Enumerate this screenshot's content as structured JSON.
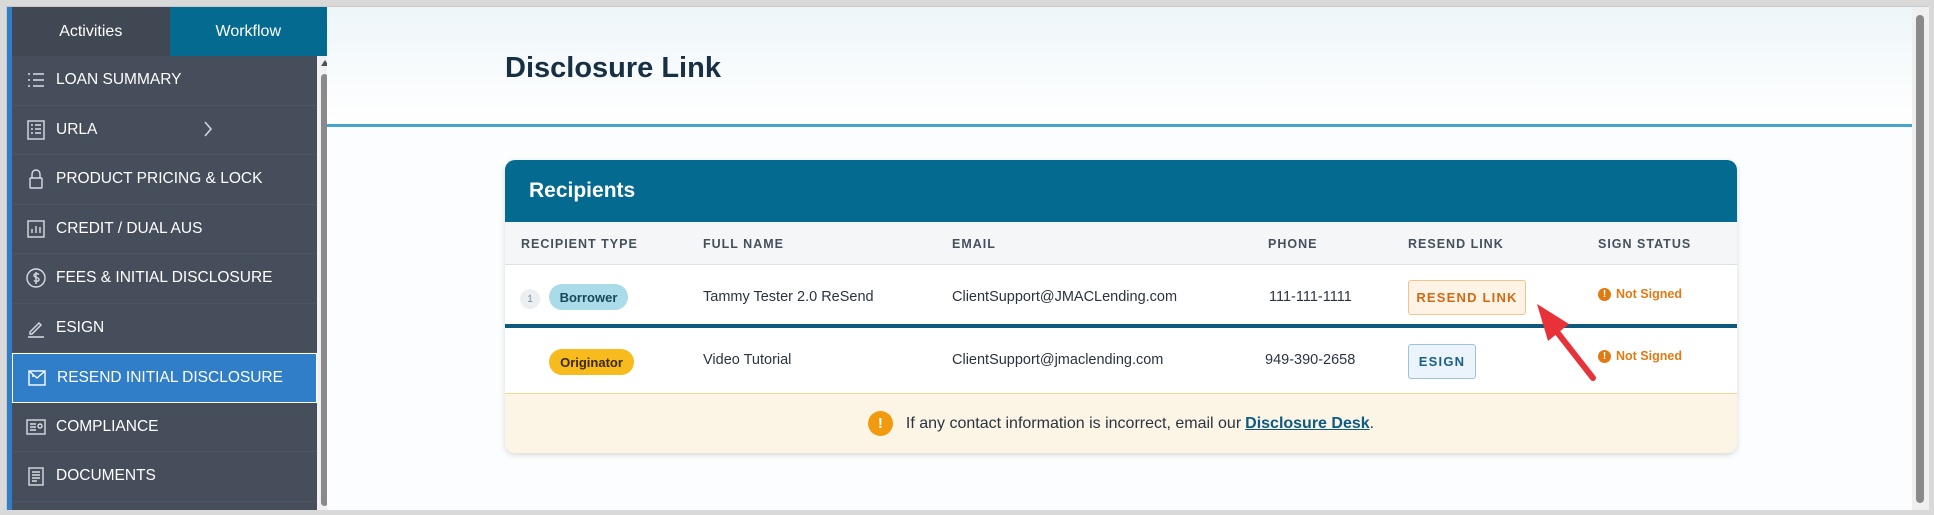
{
  "sidebar": {
    "tabs": [
      {
        "label": "Activities"
      },
      {
        "label": "Workflow"
      }
    ],
    "items": [
      {
        "label": "LOAN SUMMARY",
        "icon": "list-icon"
      },
      {
        "label": "URLA",
        "icon": "form-icon"
      },
      {
        "label": "PRODUCT PRICING & LOCK",
        "icon": "lock-icon"
      },
      {
        "label": "CREDIT / DUAL AUS",
        "icon": "chart-icon"
      },
      {
        "label": "FEES & INITIAL DISCLOSURE",
        "icon": "dollar-icon"
      },
      {
        "label": "ESIGN",
        "icon": "signature-icon"
      },
      {
        "label": "RESEND INITIAL DISCLOSURE",
        "icon": "envelope-icon"
      },
      {
        "label": "COMPLIANCE",
        "icon": "id-card-icon"
      },
      {
        "label": "DOCUMENTS",
        "icon": "document-icon"
      }
    ]
  },
  "page": {
    "title": "Disclosure Link"
  },
  "recipients": {
    "title": "Recipients",
    "columns": [
      "RECIPIENT TYPE",
      "FULL NAME",
      "EMAIL",
      "PHONE",
      "RESEND LINK",
      "SIGN STATUS"
    ],
    "rows": [
      {
        "index": "1",
        "type": "Borrower",
        "name": "Tammy Tester 2.0 ReSend",
        "email": "ClientSupport@JMACLending.com",
        "phone": "111-111-1111",
        "action": "RESEND LINK",
        "status": "Not Signed"
      },
      {
        "type": "Originator",
        "name": "Video Tutorial",
        "email": "ClientSupport@jmaclending.com",
        "phone": "949-390-2658",
        "action": "ESIGN",
        "status": "Not Signed"
      }
    ],
    "notice": {
      "text": "If any contact information is incorrect, email our",
      "link": "Disclosure Desk",
      "suffix": "."
    }
  },
  "colors": {
    "header_teal": "#046a8f",
    "active_nav": "#2f7ec7",
    "status_orange": "#e07a13",
    "borrower_pill": "#a9dce8",
    "originator_pill": "#f7bb1d",
    "annotation_arrow": "#e8323a"
  }
}
